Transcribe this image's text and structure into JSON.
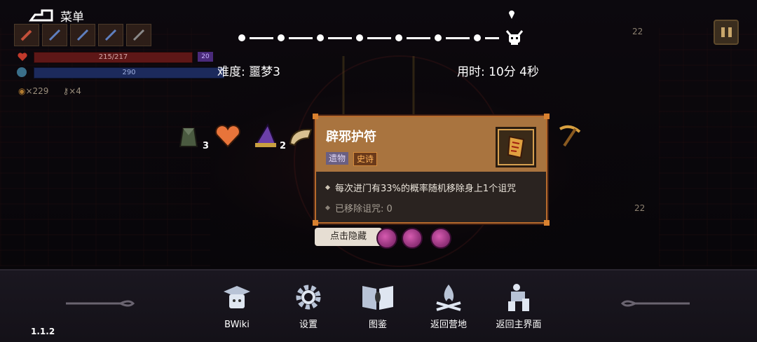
{
  "hud": {
    "menu_label": "菜单",
    "hp_text": "215/217",
    "hp_extra": "20",
    "mp_text": "290",
    "coins": "×229",
    "keys": "×4",
    "room_numbers": [
      "22",
      "22"
    ]
  },
  "run": {
    "difficulty": "难度: 噩梦3",
    "time": "用时: 10分 4秒",
    "progress_nodes": 7,
    "progress_current": 7
  },
  "items": [
    {
      "icon": "cloak-icon",
      "count": "3"
    },
    {
      "icon": "heart-relic-icon",
      "count": ""
    },
    {
      "icon": "wizard-hat-icon",
      "count": "2"
    },
    {
      "icon": "horn-icon",
      "count": ""
    },
    {
      "icon": "pickaxe-icon",
      "count": ""
    }
  ],
  "tooltip": {
    "title": "辟邪护符",
    "tag_type": "遗物",
    "tag_rarity": "史诗",
    "description": "每次进门有33%的概率随机移除身上1个诅咒",
    "stat": "已移除诅咒: 0",
    "icon": "talisman-icon"
  },
  "hide_button": "点击隐藏",
  "curses": [
    "curse-icon-1",
    "curse-icon-2",
    "curse-icon-3"
  ],
  "nav": [
    {
      "label": "BWiki",
      "icon": "bwiki-icon"
    },
    {
      "label": "设置",
      "icon": "gear-icon"
    },
    {
      "label": "图鉴",
      "icon": "book-icon"
    },
    {
      "label": "返回营地",
      "icon": "campfire-icon"
    },
    {
      "label": "返回主界面",
      "icon": "statue-icon"
    }
  ],
  "version": "1.1.2",
  "colors": {
    "accent": "#b66a2c",
    "tooltip_header": "#a9743f",
    "rarity_epic": "#ffb45a",
    "hp": "#5e1717",
    "mp": "#1c2a5c"
  }
}
